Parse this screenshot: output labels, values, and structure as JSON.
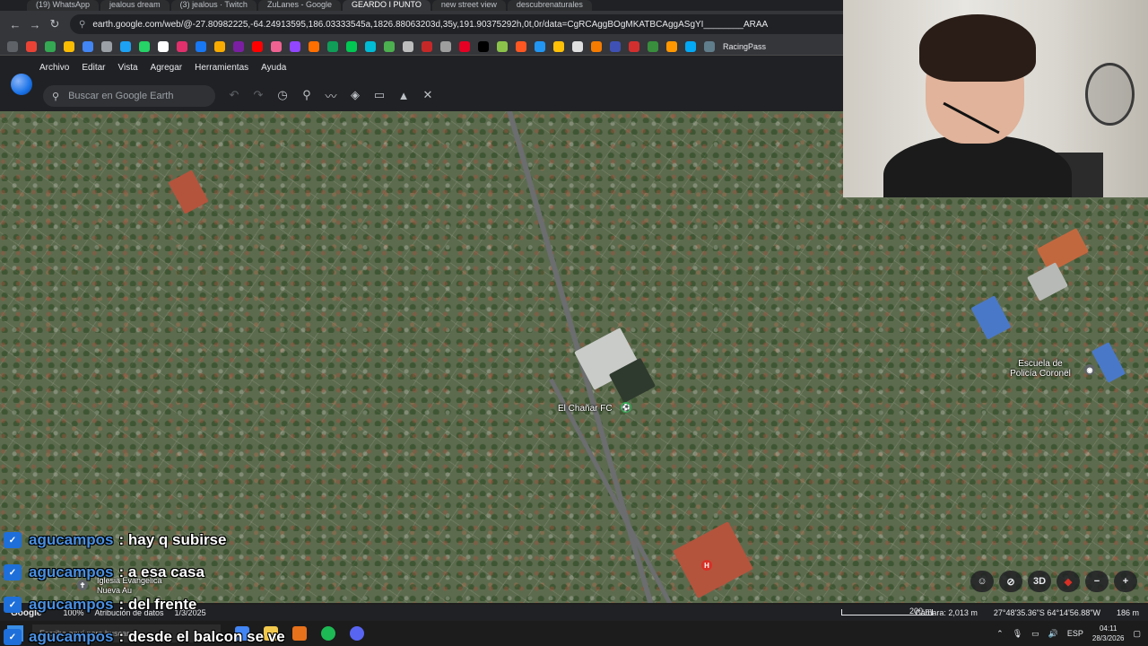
{
  "browser": {
    "tabs": [
      "(19) WhatsApp",
      "jealous dream",
      "(3) jealous · Twitch",
      "ZuLanes - Google",
      "GEARDO I PUNTO",
      "new street view",
      "descubrenaturales"
    ],
    "url": "earth.google.com/web/@-27.80982225,-64.24913595,186.03333545a,1826.88063203d,35y,191.90375292h,0t,0r/data=CgRCAggBOgMKATBCAggASgYI________ARAA",
    "bookmark_label": "RacingPass"
  },
  "earth": {
    "menu": [
      "Archivo",
      "Editar",
      "Vista",
      "Agregar",
      "Herramientas",
      "Ayuda"
    ],
    "search_placeholder": "Buscar en Google Earth"
  },
  "map": {
    "labels": {
      "club": "El Chañar FC",
      "school": "Escuela de Policía Coronel",
      "church": "Iglesia Evangelica Nueva Au"
    }
  },
  "chat": [
    {
      "user": "agucampos",
      "message": ": hay q subirse"
    },
    {
      "user": "agucampos",
      "message": ": a esa casa"
    },
    {
      "user": "agucampos",
      "message": ": del frente"
    },
    {
      "user": "agucampos",
      "message": ": desde el balcon se ve"
    }
  ],
  "map_controls": {
    "three_d": "3D",
    "zoom_out": "−",
    "zoom_in": "+"
  },
  "footer": {
    "brand": "Google",
    "zoom": "100%",
    "attribution": "Atribución de datos",
    "date": "1/3/2025",
    "scale": "200 m",
    "camera": "Cámara: 2,013 m",
    "coords": "27°48'35.36\"S 64°14'56.88\"W",
    "elevation": "186 m"
  },
  "taskbar": {
    "search_placeholder": "Escribe aquí para buscar",
    "language": "ESP",
    "time": "04:11",
    "date": "28/3/2026"
  },
  "colors": {
    "chat_user": "#4a90e2",
    "accent": "#1a73e8",
    "club_pin": "#34a853",
    "hospital_pin": "#d93025"
  }
}
